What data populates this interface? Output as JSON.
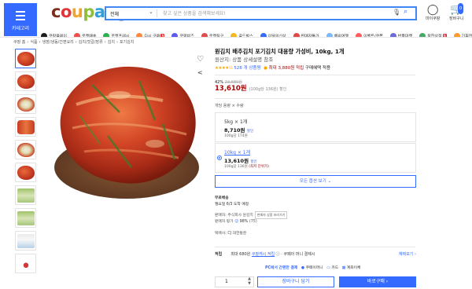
{
  "header": {
    "menu_label": "카테고리",
    "search": {
      "category": "전체",
      "placeholder": "찾고 싶은 상품을 검색해보세요!"
    },
    "my_coupang": "마이쿠팡",
    "cart": "장바구니",
    "cart_count": "0"
  },
  "category_strip": [
    {
      "label": "쿠팡플레이",
      "color": "#1d1d1d",
      "new": false
    },
    {
      "label": "로켓배송",
      "color": "#f04d4d",
      "new": false
    },
    {
      "label": "로켓프레시",
      "color": "#2bb24c",
      "new": false
    },
    {
      "label": "다시 구매",
      "color": "#ff8a3d",
      "new": true
    },
    {
      "label": "쿠팡비즈",
      "color": "#5a5af0",
      "new": false
    },
    {
      "label": "로켓직구",
      "color": "#e14c4c",
      "new": false
    },
    {
      "label": "골드박스",
      "color": "#f6b621",
      "new": false
    },
    {
      "label": "이달의신상",
      "color": "#346aff",
      "new": false
    },
    {
      "label": "판매자특가",
      "color": "#e04848",
      "new": false
    },
    {
      "label": "해외여행",
      "color": "#7ab8ff",
      "new": false
    },
    {
      "label": "이벤트/쿠폰",
      "color": "#ff5e5e",
      "new": false
    },
    {
      "label": "반품마켓",
      "color": "#6b6bd9",
      "new": false
    },
    {
      "label": "착한상점",
      "color": "#46a96b",
      "new": true
    },
    {
      "label": "기획전",
      "color": "#ff9a2e",
      "new": false
    }
  ],
  "breadcrumb": [
    "쿠팡 홈",
    "식품",
    "냉장/냉동/간편요리",
    "김치/젓갈/장류",
    "김치",
    "포기김치"
  ],
  "product": {
    "title": "원김치 배추김치 포기김치 대용량 가성비, 10kg, 1개",
    "subtitle": "원산지: 상품 상세설명 참조",
    "rating_stars": "★★★★½",
    "review_count": "528 개 상품평",
    "cashback_text": "최대 3,880원 적립",
    "cashback_note": "구매혜택 적용",
    "discount_pct": "42%",
    "original_price": "23,680원",
    "price": "13,610원",
    "unit_price": "(100g당 136원) 할인",
    "option_title": "개당 용량 × 수량"
  },
  "options": [
    {
      "qty": "5kg × 1개",
      "price": "8,710원",
      "tag": "할인",
      "unit": "100g당 174원",
      "lowest": "",
      "selected": false
    },
    {
      "qty": "10kg × 1개",
      "price": "13,610원",
      "tag": "할인",
      "unit": "100g당 136원",
      "lowest": "(최저 단위가)",
      "selected": true
    }
  ],
  "all_options_button": "모든 옵션 보기 ⌄",
  "shipping": {
    "title": "무료배송",
    "arrival": "월요일 6/3 도착 예정",
    "seller_label": "판매자: 주식회사 원김치",
    "seller_button": "판매자 상품 보러가기",
    "feedback_label": "판매자 평가",
    "feedback_value": "98%",
    "feedback_count": "(75)",
    "courier": "택배사: CJ 대한통운"
  },
  "reward": {
    "label": "적립",
    "max": "최대 680원",
    "link": "쿠팡캐시 적립",
    "extra": "쿠페이 머니 결제시",
    "more": "혜택보기 ›"
  },
  "payment_note_prefix": "PC에서 간편한 결제",
  "payment_methods": [
    "쿠페이머니",
    "카드",
    "계좌이체"
  ],
  "purchase": {
    "quantity": "1",
    "cart_button": "장바구니 담기",
    "buy_button": "바로구매 ›"
  },
  "colors": {
    "accent": "#346aff",
    "price_red": "#ae0000",
    "star": "#f8a900"
  }
}
